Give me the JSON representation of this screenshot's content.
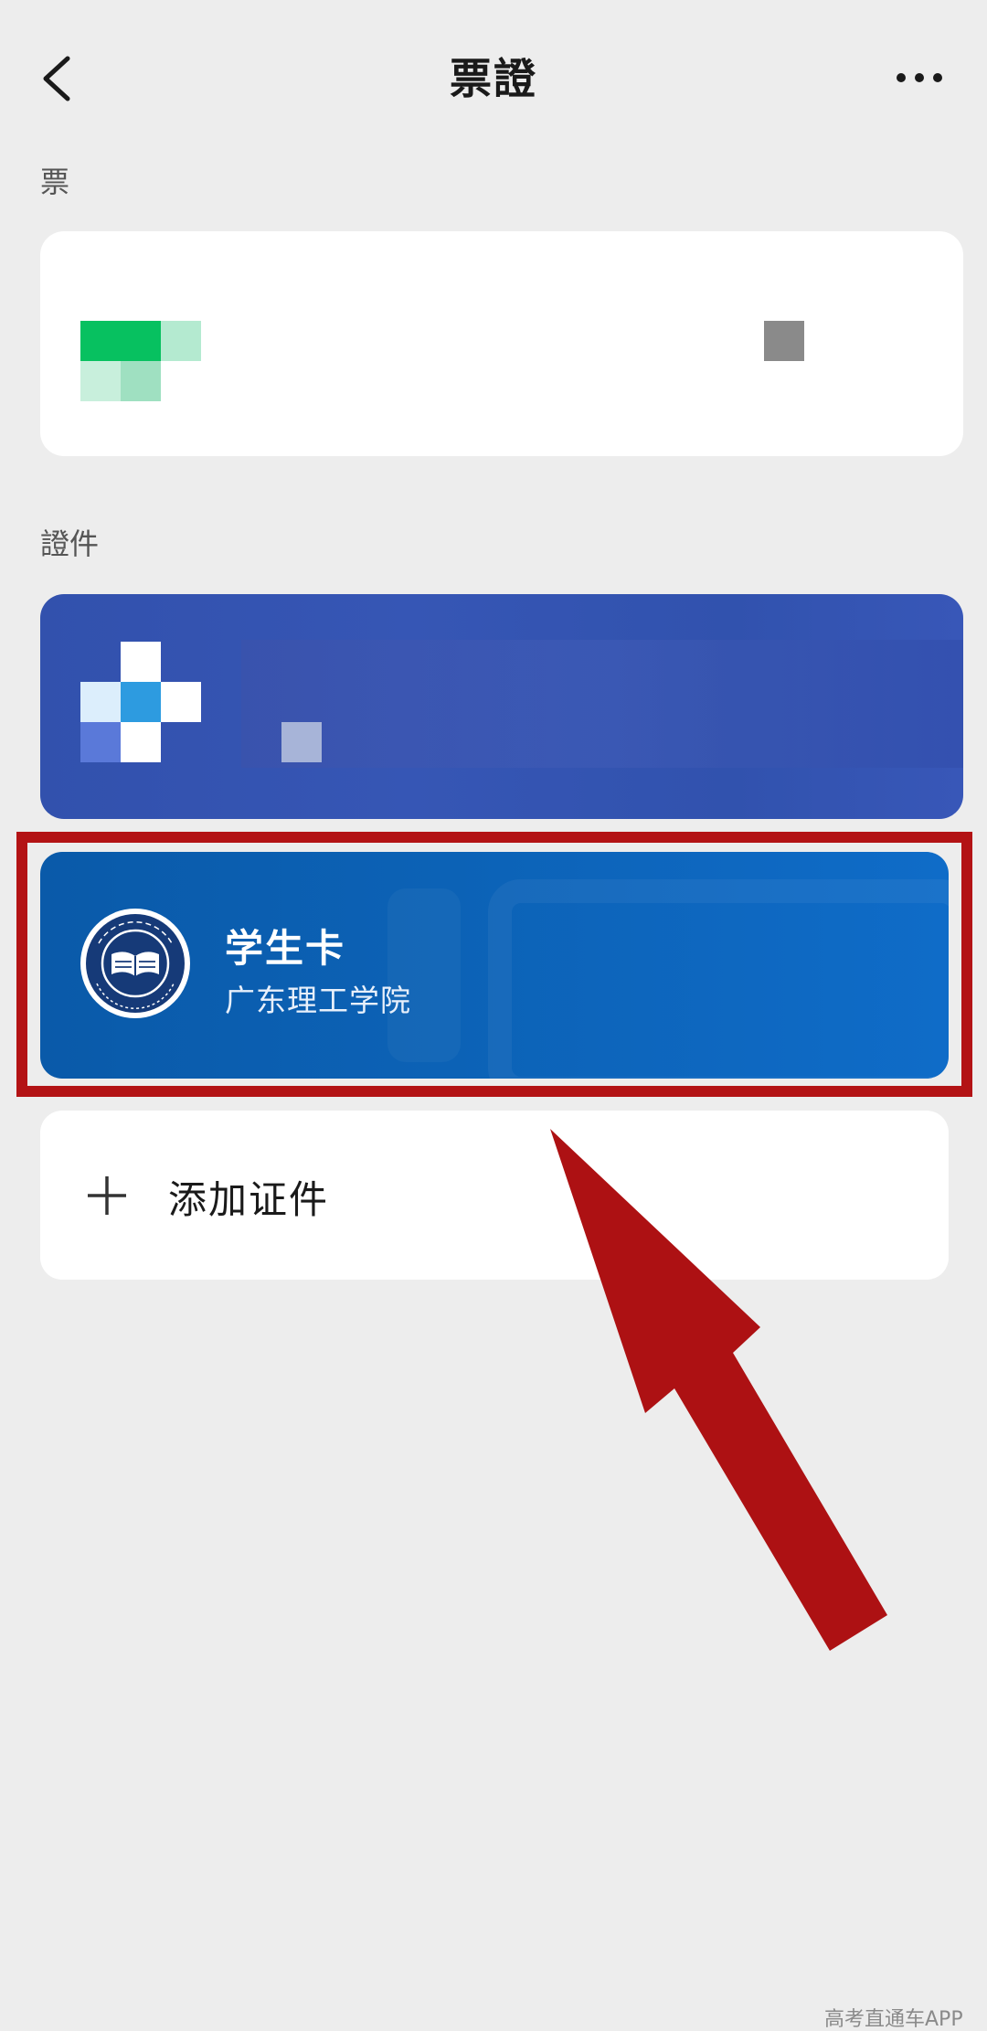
{
  "header": {
    "title": "票證"
  },
  "sections": {
    "tickets_label": "票",
    "certificates_label": "證件"
  },
  "student_card": {
    "title": "学生卡",
    "school": "广东理工学院"
  },
  "add_card": {
    "label": "添加证件"
  },
  "watermark": "高考直通车APP",
  "colors": {
    "page_background": "#ededed",
    "student_card": "#0c62b6",
    "certificate_card": "#3453b1",
    "highlight": "#b31315"
  },
  "icons": {
    "back": "chevron-left-icon",
    "more": "more-dots-icon",
    "add": "plus-icon",
    "school_logo": "school-emblem-icon"
  }
}
